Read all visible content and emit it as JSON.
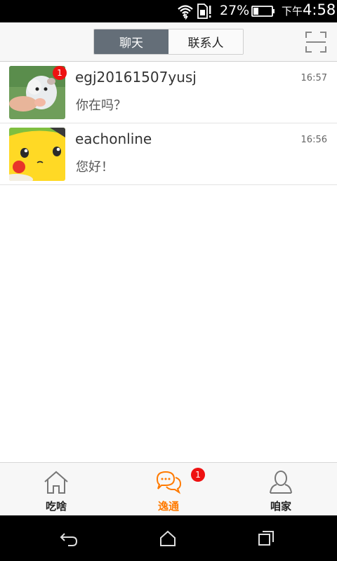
{
  "status_bar": {
    "battery_percent": "27%",
    "time_prefix": "下午",
    "time": "4:58",
    "icons": [
      "wifi-icon",
      "sim-alert-icon",
      "battery-icon"
    ]
  },
  "header": {
    "tabs": [
      {
        "label": "聊天",
        "active": true
      },
      {
        "label": "联系人",
        "active": false
      }
    ],
    "scan_icon": "scan-icon"
  },
  "chats": [
    {
      "name": "egj20161507yusj",
      "message": "你在吗？",
      "time": "16:57",
      "unread": "1",
      "avatar": "hamster-avatar"
    },
    {
      "name": "eachonline",
      "message": "您好！",
      "time": "16:56",
      "unread": "",
      "avatar": "pikachu-avatar"
    }
  ],
  "tabbar": {
    "items": [
      {
        "label": "吃啥",
        "icon": "home-icon",
        "active": false
      },
      {
        "label": "逸通",
        "icon": "chat-bubbles-icon",
        "active": true,
        "badge": "1"
      },
      {
        "label": "咱家",
        "icon": "person-icon",
        "active": false
      }
    ]
  },
  "colors": {
    "accent": "#ff7a00",
    "segment_active": "#646e78",
    "badge": "#ee1111"
  }
}
